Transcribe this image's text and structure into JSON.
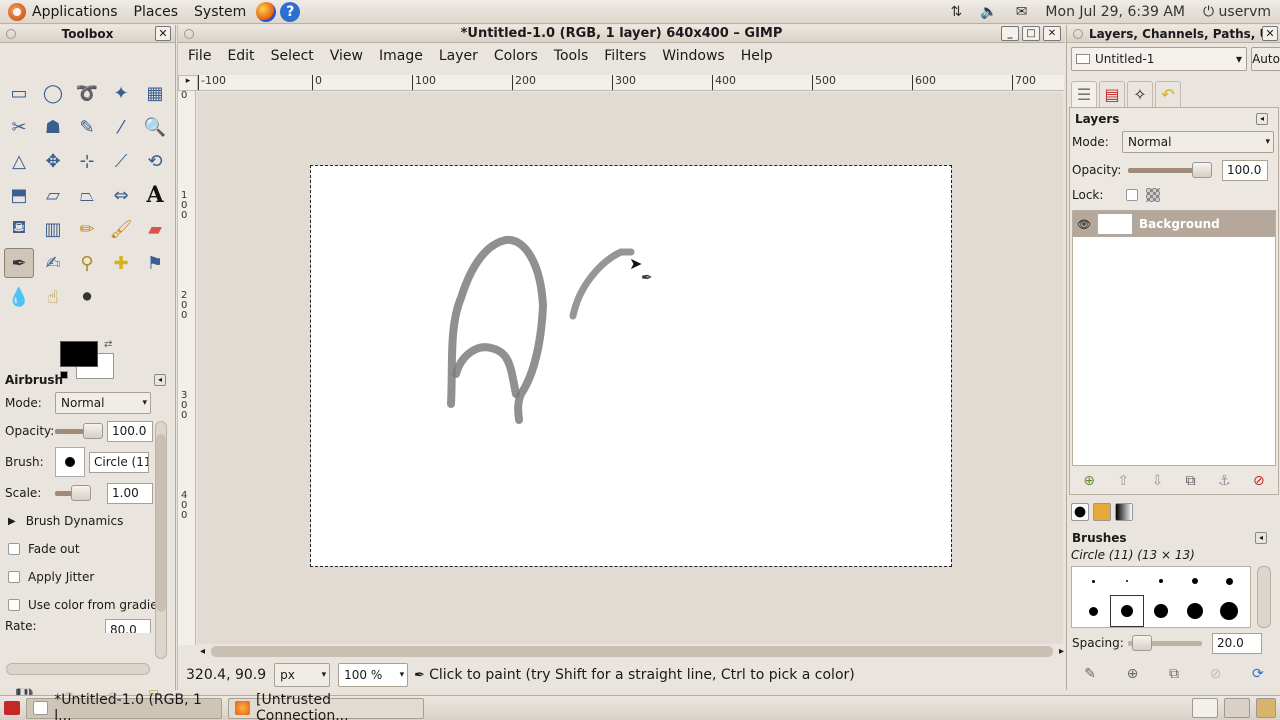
{
  "top_panel": {
    "menus": [
      "Applications",
      "Places",
      "System"
    ],
    "datetime": "Mon Jul 29,  6:39 AM",
    "user": "uservm"
  },
  "toolbox": {
    "title": "Toolbox",
    "close": "✕",
    "tool_options_title": "Airbrush",
    "mode_label": "Mode:",
    "mode_value": "Normal",
    "opacity_label": "Opacity:",
    "opacity_value": "100.0",
    "brush_label": "Brush:",
    "brush_value": "Circle (11)",
    "scale_label": "Scale:",
    "scale_value": "1.00",
    "brush_dynamics": "Brush Dynamics",
    "fade_out": "Fade out",
    "apply_jitter": "Apply Jitter",
    "use_color": "Use color from gradie",
    "rate_label": "Rate:",
    "rate_value": "80.0"
  },
  "image_window": {
    "title": "*Untitled-1.0 (RGB, 1 layer) 640x400 – GIMP",
    "menus": [
      "File",
      "Edit",
      "Select",
      "View",
      "Image",
      "Layer",
      "Colors",
      "Tools",
      "Filters",
      "Windows",
      "Help"
    ],
    "h_ruler_labels": [
      "-100",
      "0",
      "100",
      "200",
      "300",
      "400",
      "500",
      "600",
      "700"
    ],
    "v_ruler_labels": [
      "0",
      "100",
      "200",
      "300",
      "400"
    ],
    "coords": "320.4, 90.9",
    "unit": "px",
    "zoom": "100 %",
    "status_message": "Click to paint (try Shift for a straight line, Ctrl to pick a color)"
  },
  "dock": {
    "title": "Layers, Channels, Paths, U",
    "image_select": "Untitled-1",
    "auto_label": "Auto",
    "layers_title": "Layers",
    "mode_label": "Mode:",
    "mode_value": "Normal",
    "opacity_label": "Opacity:",
    "opacity_value": "100.0",
    "lock_label": "Lock:",
    "layer_name": "Background",
    "brushes_title": "Brushes",
    "brush_name": "Circle (11) (13 × 13)",
    "spacing_label": "Spacing:",
    "spacing_value": "20.0"
  },
  "taskbar": {
    "tasks": [
      "*Untitled-1.0 (RGB, 1 l...",
      "[Untrusted Connection..."
    ]
  }
}
